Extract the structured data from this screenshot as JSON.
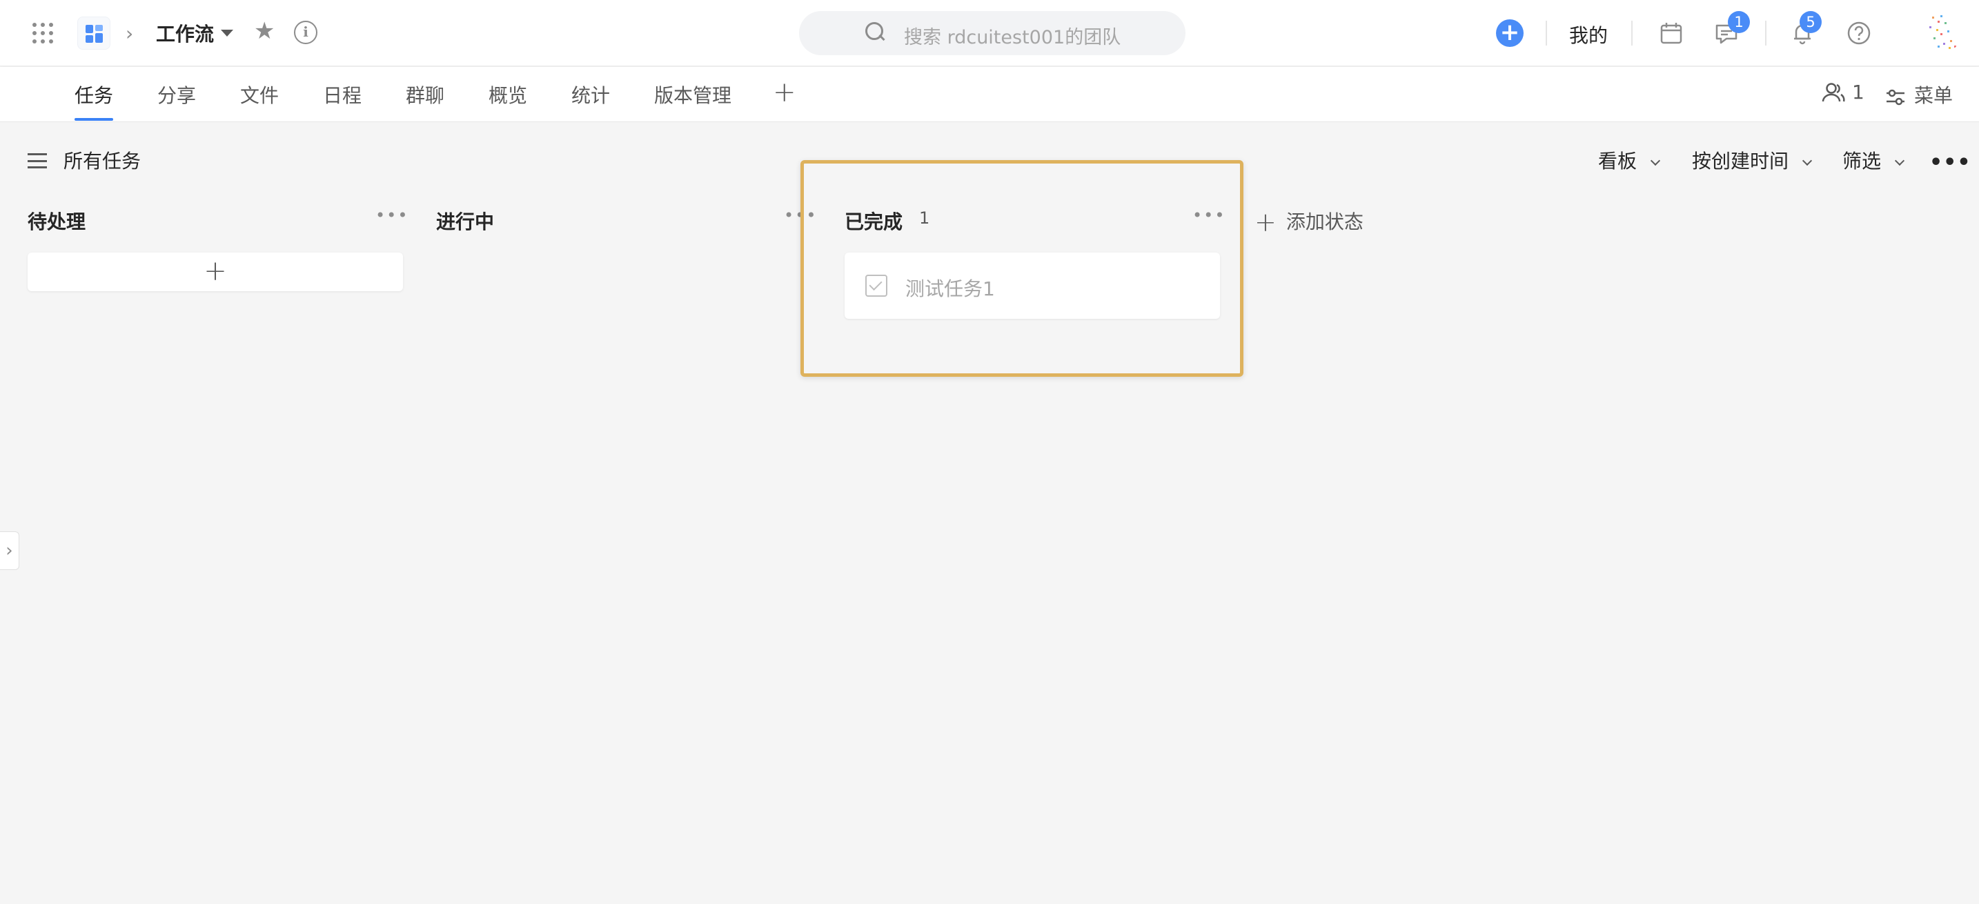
{
  "header": {
    "project_name": "工作流",
    "search_placeholder": "搜索 rdcuitest001的团队",
    "mine_label": "我的",
    "messages_badge": "1",
    "notifications_badge": "5",
    "icons": [
      "apps-grid-icon",
      "project-logo-icon",
      "star-icon",
      "info-icon",
      "search-icon",
      "plus-circle-icon",
      "calendar-icon",
      "message-icon",
      "bell-icon",
      "help-icon"
    ],
    "accent_color": "#4a8cf7"
  },
  "tabs": [
    {
      "label": "任务",
      "active": true
    },
    {
      "label": "分享"
    },
    {
      "label": "文件"
    },
    {
      "label": "日程"
    },
    {
      "label": "群聊"
    },
    {
      "label": "概览"
    },
    {
      "label": "统计"
    },
    {
      "label": "版本管理"
    }
  ],
  "tabbar_right": {
    "member_count": "1",
    "menu_label": "菜单"
  },
  "toolbar": {
    "all_tasks_label": "所有任务",
    "view_label": "看板",
    "sort_label": "按创建时间",
    "filter_label": "筛选"
  },
  "columns": [
    {
      "title": "待处理",
      "count": "",
      "cards": []
    },
    {
      "title": "进行中",
      "count": "",
      "cards": []
    },
    {
      "title": "已完成",
      "count": "1",
      "cards": [
        {
          "title": "测试任务1",
          "done": true
        }
      ]
    }
  ],
  "add_status_label": "添加状态",
  "highlight_color": "#deb25d"
}
